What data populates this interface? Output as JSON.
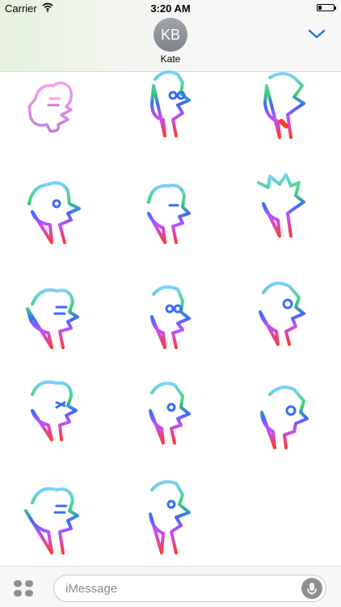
{
  "status_bar": {
    "carrier": "Carrier",
    "time": "3:20 AM"
  },
  "header": {
    "avatar_initials": "KB",
    "contact_name": "Kate",
    "accent": "#1a73e8"
  },
  "composer": {
    "placeholder": "iMessage"
  },
  "stickers": [
    {
      "name": "sticker-1-1"
    },
    {
      "name": "sticker-1-2"
    },
    {
      "name": "sticker-1-3"
    },
    {
      "name": "sticker-2-1"
    },
    {
      "name": "sticker-2-2"
    },
    {
      "name": "sticker-2-3"
    },
    {
      "name": "sticker-3-1"
    },
    {
      "name": "sticker-3-2"
    },
    {
      "name": "sticker-3-3"
    },
    {
      "name": "sticker-4-1"
    },
    {
      "name": "sticker-4-2"
    },
    {
      "name": "sticker-4-3"
    },
    {
      "name": "sticker-5-1"
    },
    {
      "name": "sticker-5-2"
    }
  ],
  "icons": [
    "wifi-icon",
    "battery-icon",
    "chevron-down-icon",
    "apps-grid-icon",
    "microphone-icon"
  ]
}
